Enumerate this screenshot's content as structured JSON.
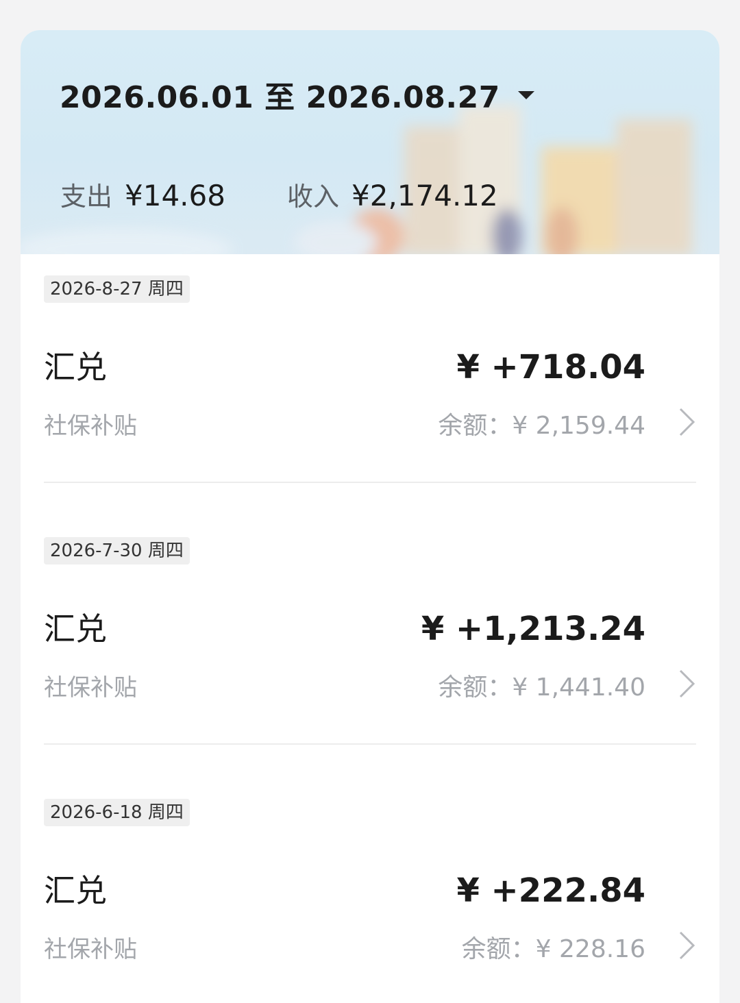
{
  "header": {
    "date_range": "2026.06.01 至 2026.08.27",
    "expense_label": "支出",
    "expense_value": "¥14.68",
    "income_label": "收入",
    "income_value": "¥2,174.12"
  },
  "entries": [
    {
      "date": "2026-8-27 周四",
      "title": "汇兑",
      "amount": "¥ +718.04",
      "subtitle": "社保补贴",
      "balance": "余额：¥ 2,159.44"
    },
    {
      "date": "2026-7-30 周四",
      "title": "汇兑",
      "amount": "¥ +1,213.24",
      "subtitle": "社保补贴",
      "balance": "余额：¥ 1,441.40"
    },
    {
      "date": "2026-6-18 周四",
      "title": "汇兑",
      "amount": "¥ +222.84",
      "subtitle": "社保补贴",
      "balance": "余额：¥ 228.16"
    }
  ]
}
